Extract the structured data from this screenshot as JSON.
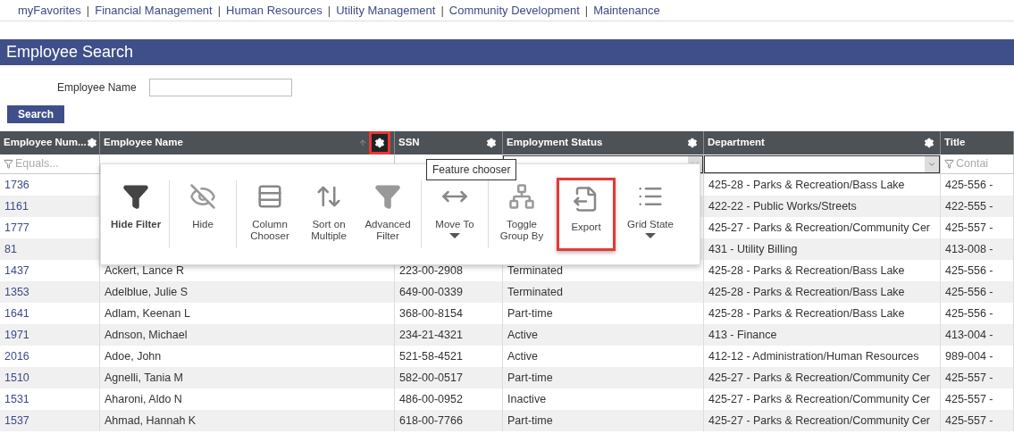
{
  "nav": [
    {
      "label": "myFavorites"
    },
    {
      "label": "Financial Management"
    },
    {
      "label": "Human Resources"
    },
    {
      "label": "Utility Management"
    },
    {
      "label": "Community Development"
    },
    {
      "label": "Maintenance"
    }
  ],
  "nav_separator": "|",
  "page_title": "Employee Search",
  "search_form": {
    "label": "Employee Name",
    "button": "Search"
  },
  "table": {
    "columns": [
      {
        "label": "Employee Num...",
        "gear_highlighted": false,
        "sortable_icon": false,
        "filter": {
          "kind": "text",
          "placeholder": "Equals..."
        }
      },
      {
        "label": "Employee Name",
        "gear_highlighted": true,
        "sortable_icon": true,
        "filter": {
          "kind": "hidden"
        }
      },
      {
        "label": "SSN",
        "gear_highlighted": false,
        "sortable_icon": false,
        "filter": {
          "kind": "hidden"
        }
      },
      {
        "label": "Employment Status",
        "gear_highlighted": false,
        "sortable_icon": false,
        "filter": {
          "kind": "dropdown"
        }
      },
      {
        "label": "Department",
        "gear_highlighted": false,
        "sortable_icon": false,
        "filter": {
          "kind": "dropdown"
        }
      },
      {
        "label": "Title",
        "sortable_icon": false,
        "filter": {
          "kind": "text",
          "placeholder": "Contai"
        }
      }
    ],
    "rows": [
      [
        "1736",
        null,
        null,
        null,
        "425-28 - Parks & Recreation/Bass Lake",
        "425-556 -"
      ],
      [
        "1161",
        null,
        null,
        null,
        "422-22 - Public Works/Streets",
        "422-555 -"
      ],
      [
        "1777",
        null,
        null,
        null,
        "425-27 - Parks & Recreation/Community Cer",
        "425-557 -"
      ],
      [
        "81",
        null,
        null,
        null,
        "431 - Utility Billing",
        "413-008 -"
      ],
      [
        "1437",
        "Ackert, Lance R",
        "223-00-2908",
        "Terminated",
        "425-28 - Parks & Recreation/Bass Lake",
        "425-556 -"
      ],
      [
        "1353",
        "Adelblue, Julie S",
        "649-00-0339",
        "Terminated",
        "425-28 - Parks & Recreation/Bass Lake",
        "425-556 -"
      ],
      [
        "1641",
        "Adlam, Keenan L",
        "368-00-8154",
        "Part-time",
        "425-28 - Parks & Recreation/Bass Lake",
        "425-556 -"
      ],
      [
        "1971",
        "Adnson, Michael",
        "234-21-4321",
        "Active",
        "413 - Finance",
        "413-004 -"
      ],
      [
        "2016",
        "Adoe, John",
        "521-58-4521",
        "Active",
        "412-12 - Administration/Human Resources",
        "989-004 -"
      ],
      [
        "1510",
        "Agnelli, Tania M",
        "582-00-0517",
        "Part-time",
        "425-27 - Parks & Recreation/Community Cer",
        "425-557 -"
      ],
      [
        "1531",
        "Aharoni, Aldo N",
        "486-00-0952",
        "Inactive",
        "425-27 - Parks & Recreation/Community Cer",
        "425-557 -"
      ],
      [
        "1537",
        "Ahmad, Hannah K",
        "618-00-7766",
        "Part-time",
        "425-27 - Parks & Recreation/Community Cer",
        "425-557 -"
      ]
    ]
  },
  "tooltip": "Feature chooser",
  "feature_menu": [
    {
      "kind": "filter",
      "label": "Hide Filter",
      "active": true,
      "highlighted": false,
      "dropdown": false
    },
    {
      "kind": "hide",
      "label": "Hide",
      "active": false,
      "highlighted": false,
      "dropdown": false
    },
    {
      "kind": "columns",
      "label": "Column Chooser",
      "active": false,
      "highlighted": false,
      "dropdown": false
    },
    {
      "kind": "sort",
      "label": "Sort on Multiple",
      "active": false,
      "highlighted": false,
      "dropdown": false
    },
    {
      "kind": "advanced",
      "label": "Advanced Filter",
      "active": false,
      "highlighted": false,
      "dropdown": false
    },
    {
      "kind": "move",
      "label": "Move To",
      "active": false,
      "highlighted": false,
      "dropdown": true
    },
    {
      "kind": "group",
      "label": "Toggle Group By",
      "active": false,
      "highlighted": false,
      "dropdown": false
    },
    {
      "kind": "export",
      "label": "Export",
      "active": false,
      "highlighted": true,
      "dropdown": false
    },
    {
      "kind": "gridstate",
      "label": "Grid State",
      "active": false,
      "highlighted": false,
      "dropdown": true
    }
  ]
}
